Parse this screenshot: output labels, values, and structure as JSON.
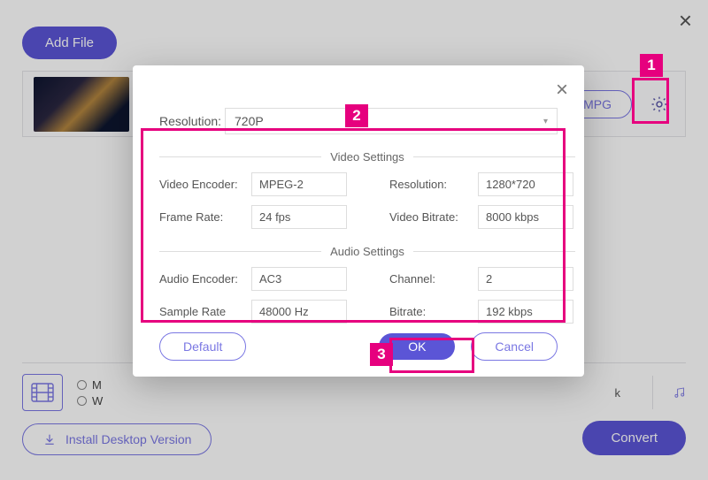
{
  "header": {
    "add_file_label": "Add File"
  },
  "media_row": {
    "format_button": "MPG"
  },
  "bottom": {
    "radio1_prefix": "M",
    "radio2_prefix": "W",
    "right_text_suffix": "k",
    "install_label": "Install Desktop Version",
    "convert_label": "Convert"
  },
  "modal": {
    "resolution_label": "Resolution:",
    "resolution_value": "720P",
    "video_group_title": "Video Settings",
    "video": {
      "encoder_label": "Video Encoder:",
      "encoder_value": "MPEG-2",
      "resolution_label": "Resolution:",
      "resolution_value": "1280*720",
      "frame_rate_label": "Frame Rate:",
      "frame_rate_value": "24 fps",
      "bitrate_label": "Video Bitrate:",
      "bitrate_value": "8000 kbps"
    },
    "audio_group_title": "Audio Settings",
    "audio": {
      "encoder_label": "Audio Encoder:",
      "encoder_value": "AC3",
      "channel_label": "Channel:",
      "channel_value": "2",
      "sample_rate_label": "Sample Rate",
      "sample_rate_value": "48000 Hz",
      "bitrate_label": "Bitrate:",
      "bitrate_value": "192 kbps"
    },
    "buttons": {
      "default": "Default",
      "ok": "OK",
      "cancel": "Cancel"
    }
  },
  "callouts": {
    "one": "1",
    "two": "2",
    "three": "3"
  },
  "colors": {
    "accent": "#5b55d6",
    "callout": "#e6007e"
  }
}
